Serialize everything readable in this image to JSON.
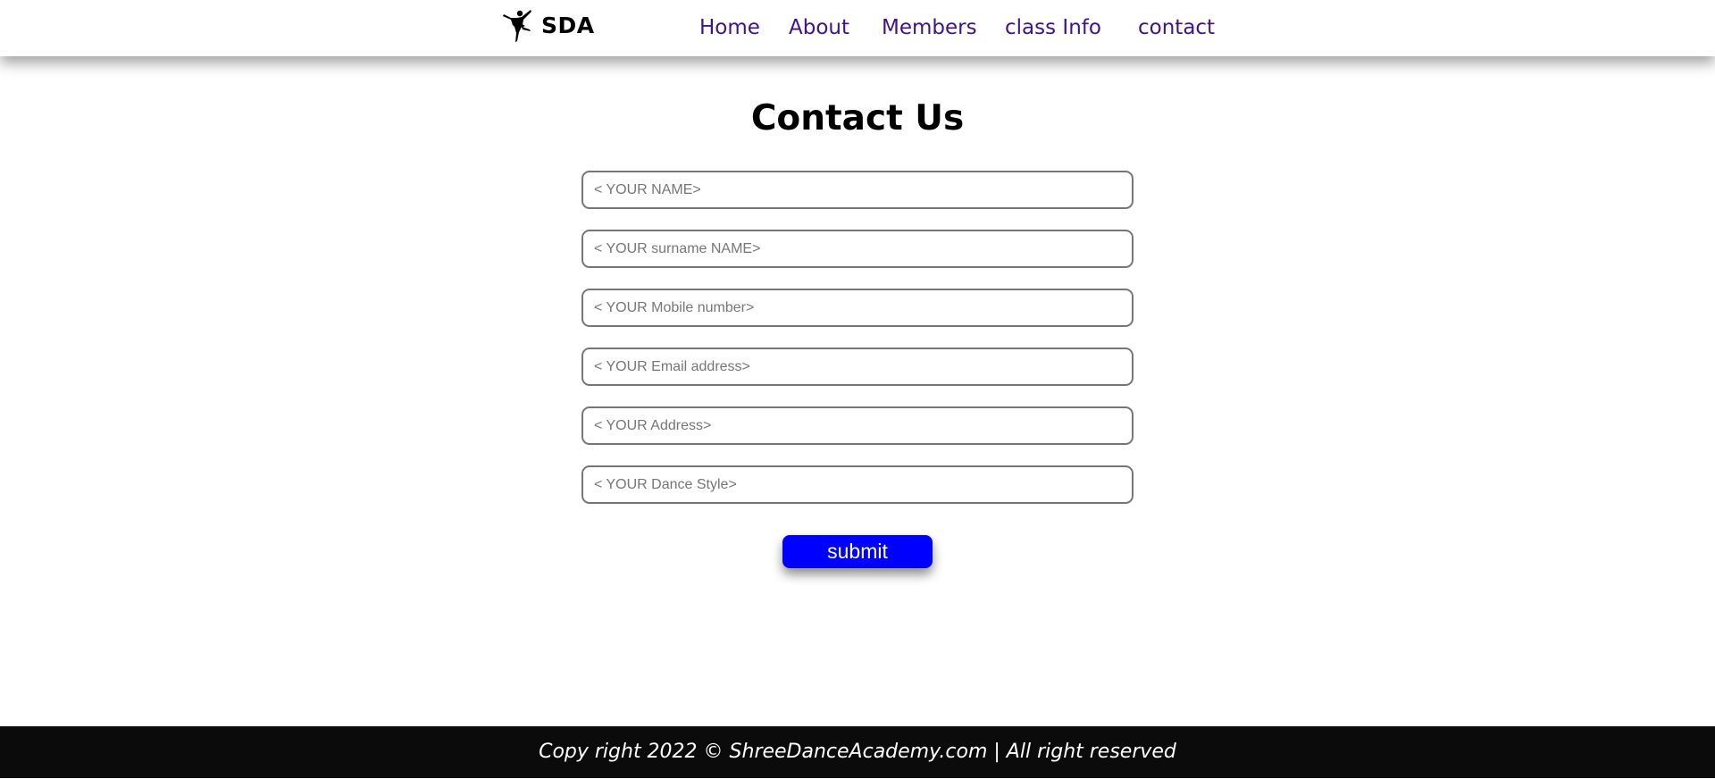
{
  "header": {
    "logo_icon": "ballerina-icon",
    "logo_text": "SDA",
    "nav": [
      {
        "label": "Home"
      },
      {
        "label": "About"
      },
      {
        "label": "Members"
      },
      {
        "label": "class Info"
      },
      {
        "label": "contact"
      }
    ],
    "nav_color": "#3f1389"
  },
  "main": {
    "title": "Contact Us",
    "fields": [
      {
        "name": "name",
        "value": "",
        "placeholder": "< YOUR NAME>"
      },
      {
        "name": "surname",
        "value": "",
        "placeholder": "< YOUR surname NAME>"
      },
      {
        "name": "mobile",
        "value": "",
        "placeholder": "< YOUR Mobile number>"
      },
      {
        "name": "email",
        "value": "",
        "placeholder": "< YOUR Email address>"
      },
      {
        "name": "address",
        "value": "",
        "placeholder": "< YOUR Address>"
      },
      {
        "name": "dance_style",
        "value": "",
        "placeholder": "< YOUR Dance Style>"
      }
    ],
    "submit_label": "submit",
    "submit_color": "#0000ff"
  },
  "footer": {
    "text": "Copy right 2022 © ShreeDanceAcademy.com | All right reserved",
    "background": "#0b0b0b"
  }
}
